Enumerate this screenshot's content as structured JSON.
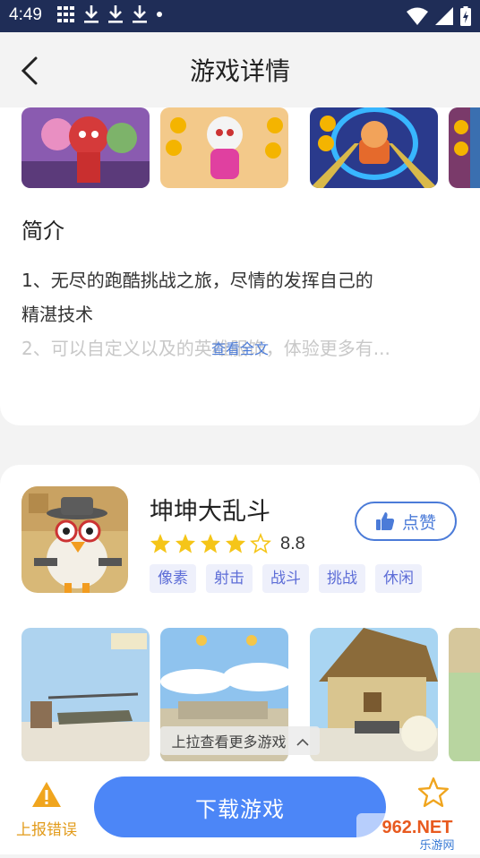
{
  "status_bar": {
    "time": "4:49"
  },
  "header": {
    "title": "游戏详情"
  },
  "intro": {
    "heading": "简介",
    "line1": "1、无尽的跑酷挑战之旅，尽情的发挥自己的",
    "line2": "精湛技术",
    "line3": "2、可以自定义以及的英雄服饰，体验更多有...",
    "read_more": "查看全文"
  },
  "related_game": {
    "name": "坤坤大乱斗",
    "rating": "8.8",
    "stars_filled": 4,
    "stars_total": 5,
    "like_label": "点赞",
    "tags": [
      "像素",
      "射击",
      "战斗",
      "挑战",
      "休闲"
    ],
    "pull_hint": "上拉查看更多游戏"
  },
  "bottom_bar": {
    "report_label": "上报错误",
    "download_label": "下载游戏"
  },
  "watermark": {
    "text_top": "962.NET",
    "text_bottom": "乐游网"
  },
  "colors": {
    "accent": "#4c86f7",
    "status_bar": "#1f2d57",
    "star": "#f5c518",
    "warning": "#e29b1a"
  }
}
